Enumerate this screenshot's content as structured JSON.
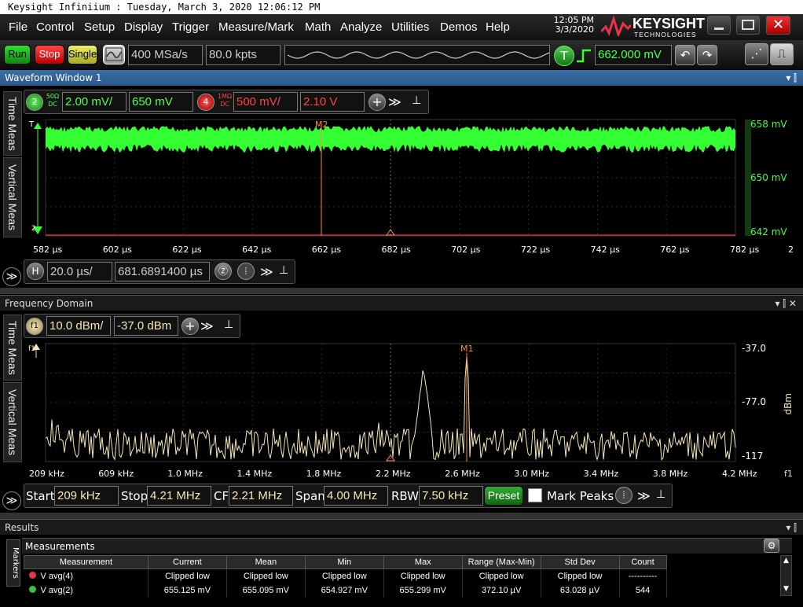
{
  "title": "Keysight Infiniium : Tuesday, March 3, 2020 12:06:12 PM",
  "menu": [
    "File",
    "Control",
    "Setup",
    "Display",
    "Trigger",
    "Measure/Mark",
    "Math",
    "Analyze",
    "Utilities",
    "Demos",
    "Help"
  ],
  "clock": {
    "time": "12:05 PM",
    "date": "3/3/2020"
  },
  "logo": {
    "name": "KEYSIGHT",
    "sub": "TECHNOLOGIES"
  },
  "toolbar": {
    "run": "Run",
    "stop": "Stop",
    "single": "Single",
    "sample_rate": "400 MSa/s",
    "memory": "80.0 kpts",
    "trigger_badge": "T",
    "trigger_level": "662.000 mV"
  },
  "waveform": {
    "title": "Waveform Window 1",
    "tabs": [
      "Time Meas",
      "Vertical Meas"
    ],
    "ch2": {
      "badge": "2",
      "coupling": "50Ω DC",
      "scale": "2.00 mV/",
      "offset": "650 mV"
    },
    "ch4": {
      "badge": "4",
      "coupling": "1MΩ DC",
      "scale": "500 mV/",
      "offset": "2.10 V"
    },
    "marker": "M2",
    "trig_marker": "T",
    "ch_marker": "2",
    "y_labels": [
      "658 mV",
      "650 mV",
      "642 mV"
    ],
    "x_labels": [
      "582 µs",
      "602 µs",
      "622 µs",
      "642 µs",
      "662 µs",
      "682 µs",
      "702 µs",
      "722 µs",
      "742 µs",
      "762 µs",
      "782 µs"
    ],
    "x_suffix": "2",
    "horizontal": {
      "badge": "H",
      "scale": "20.0 µs/",
      "position": "681.6891400 µs"
    }
  },
  "freq": {
    "title": "Frequency Domain",
    "tabs": [
      "Time Meas",
      "Vertical Meas"
    ],
    "f1": {
      "badge": "f1",
      "scale": "10.0 dBm/",
      "offset": "-37.0 dBm"
    },
    "marker": "M1",
    "y_labels": [
      "-37.0",
      "-77.0",
      "-117"
    ],
    "y_unit": "dBm",
    "x_labels": [
      "209 kHz",
      "609 kHz",
      "1.0 MHz",
      "1.4 MHz",
      "1.8 MHz",
      "2.2 MHz",
      "2.6 MHz",
      "3.0 MHz",
      "3.4 MHz",
      "3.8 MHz",
      "4.2 MHz"
    ],
    "x_suffix": "f1",
    "controls": {
      "start_label": "Start",
      "start": "209 kHz",
      "stop_label": "Stop",
      "stop": "4.21 MHz",
      "cf_label": "CF",
      "cf": "2.21 MHz",
      "span_label": "Span",
      "span": "4.00 MHz",
      "rbw_label": "RBW",
      "rbw": "7.50 kHz",
      "preset": "Preset",
      "mark_peaks": "Mark Peaks"
    }
  },
  "results": {
    "title": "Results",
    "side_tab": "Markers",
    "measurements_title": "Measurements",
    "columns": [
      "Measurement",
      "Current",
      "Mean",
      "Min",
      "Max",
      "Range (Max-Min)",
      "Std Dev",
      "Count"
    ],
    "rows": [
      {
        "name": "V avg(4)",
        "current": "Clipped low",
        "mean": "Clipped low",
        "min": "Clipped low",
        "max": "Clipped low",
        "range": "Clipped low",
        "std": "Clipped low",
        "count": "----------",
        "color": "#e8334a"
      },
      {
        "name": "V avg(2)",
        "current": "655.125 mV",
        "mean": "655.095 mV",
        "min": "654.927 mV",
        "max": "655.299 mV",
        "range": "372.10 µV",
        "std": "63.028 µV",
        "count": "544",
        "color": "#3cbf3c"
      }
    ]
  },
  "colors": {
    "ch2": "#33ff33",
    "ch4": "#e8334a",
    "f1": "#f5e6b8",
    "marker": "#ff8844",
    "accent": "#3a6ea5"
  }
}
